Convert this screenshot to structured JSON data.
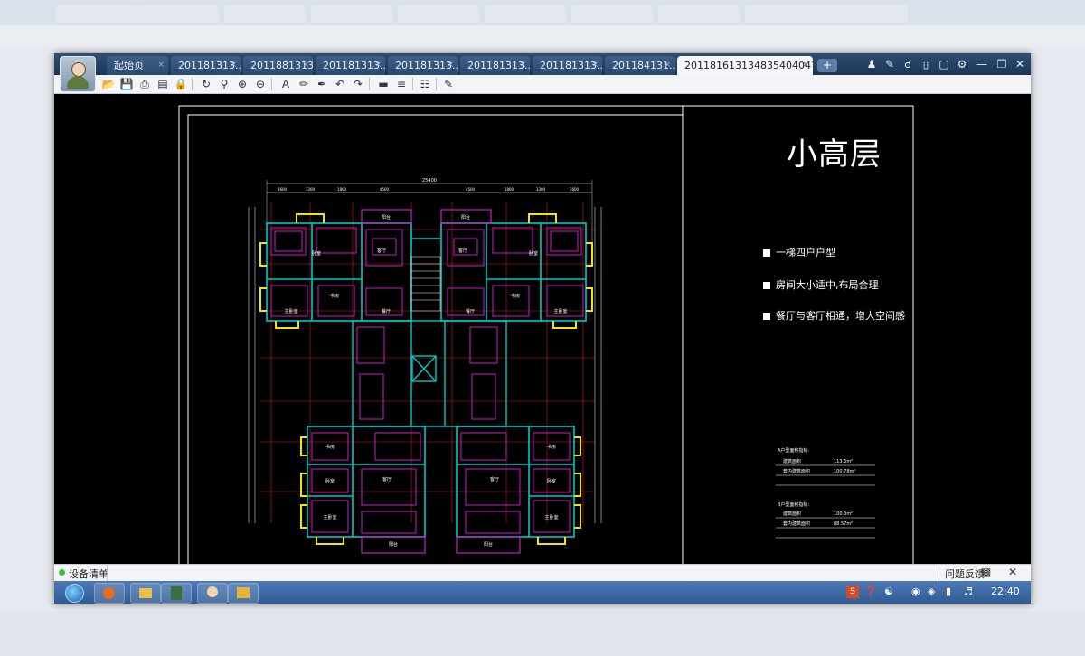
{
  "background": {
    "tabs": [
      "起始页",
      "20111813...",
      "2011181313...",
      "201118131...",
      "201118131...",
      "201181313...",
      "201181313...",
      "201184131...",
      "201181613134835404700..."
    ],
    "status_label": "设备清单"
  },
  "window": {
    "tabs": [
      {
        "label": "起始页",
        "active": false
      },
      {
        "label": "201181313...",
        "active": false
      },
      {
        "label": "2011881313...",
        "active": false
      },
      {
        "label": "201181313...",
        "active": false
      },
      {
        "label": "201181313...",
        "active": false
      },
      {
        "label": "201181313...",
        "active": false
      },
      {
        "label": "201181313...",
        "active": false
      },
      {
        "label": "201184131...",
        "active": false
      },
      {
        "label": "2011816131348354040470.d...",
        "active": true
      }
    ],
    "add_tab_label": "+",
    "tab_close_glyph": "×"
  },
  "drawing": {
    "title": "小高层",
    "bullets": [
      "一梯四户户型",
      "房间大小适中,布局合理",
      "餐厅与客厅相通，增大空间感"
    ],
    "area_a_heading": "A户型面积指标:",
    "area_a_rows": [
      {
        "label": "建筑面积",
        "value": "113.6m²"
      },
      {
        "label": "套内建筑面积",
        "value": "100.78m²"
      }
    ],
    "area_b_heading": "B户型面积指标:",
    "area_b_rows": [
      {
        "label": "建筑面积",
        "value": "100.3m²"
      },
      {
        "label": "套内建筑面积",
        "value": "88.57m²"
      }
    ],
    "overall_dim": "25400",
    "top_dims": [
      "3600",
      "3300",
      "1800",
      "4500",
      "4500",
      "1800",
      "3300",
      "3600"
    ],
    "room_labels": [
      "阳台",
      "阳台",
      "卧室",
      "客厅",
      "客厅",
      "卧室",
      "主卧室",
      "书房",
      "餐厅",
      "餐厅",
      "书房",
      "主卧室",
      "书房",
      "卧室",
      "客厅",
      "客厅",
      "卧室",
      "书房",
      "主卧室",
      "阳台",
      "阳台",
      "主卧室"
    ]
  },
  "statusbar": {
    "left_label": "设备清单",
    "feedback_label": "问题反馈",
    "chat_icon": "chat-icon",
    "close_icon": "close-icon"
  },
  "taskbar": {
    "clock": "22:40"
  },
  "colors": {
    "cad_wall": "#00c8c8",
    "cad_furniture": "#c81ec8",
    "cad_axis": "#c81e1e",
    "cad_window": "#f0e600",
    "tab_bg": "#2b4a70"
  }
}
